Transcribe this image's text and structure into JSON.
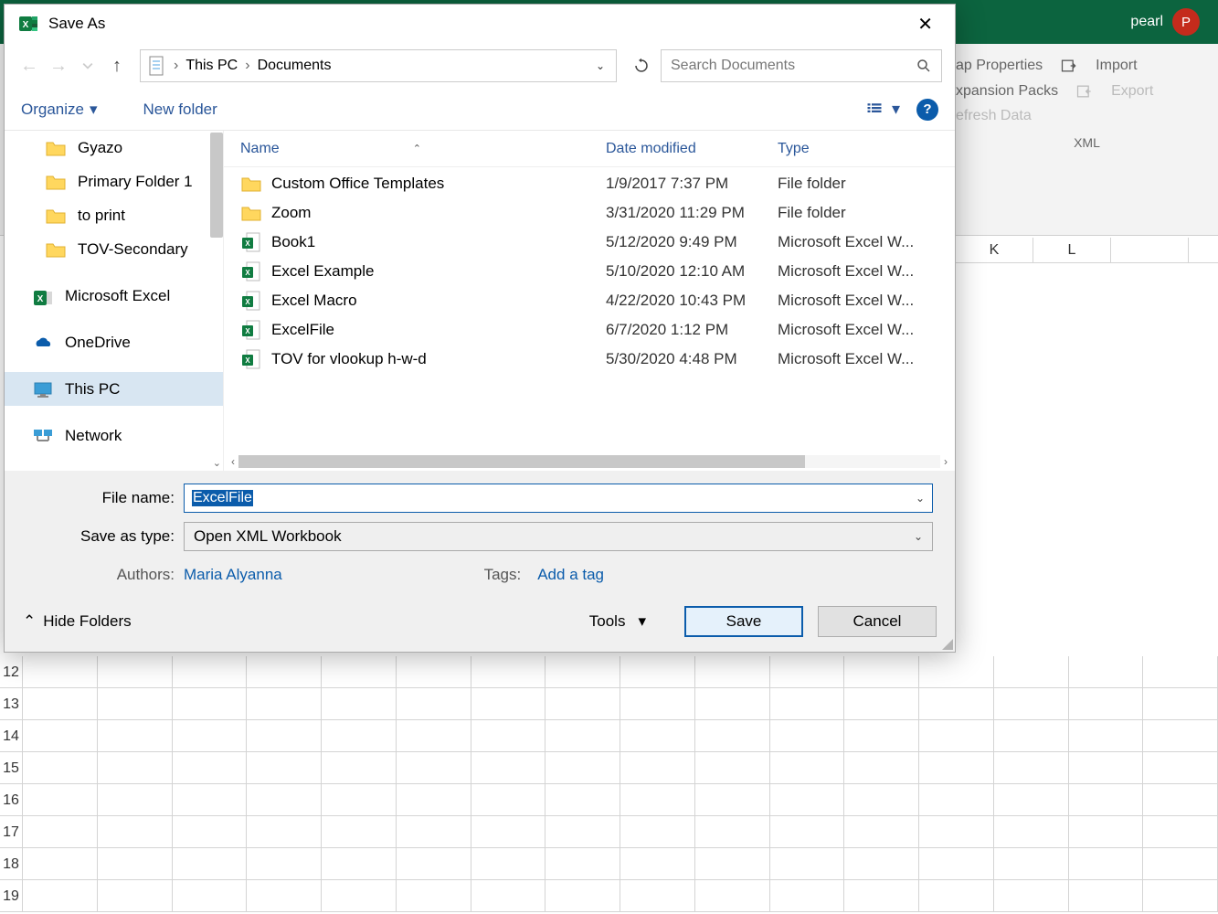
{
  "excel": {
    "user_name": "pearl",
    "user_initial": "P",
    "ribbon": {
      "group_label": "XML",
      "items": [
        "ap Properties",
        "Import",
        "xpansion Packs",
        "Export",
        "efresh Data"
      ]
    },
    "columns": [
      "K",
      "L"
    ],
    "rows_visible": [
      "12",
      "13",
      "14",
      "15",
      "16",
      "17",
      "18",
      "19"
    ]
  },
  "dialog": {
    "title": "Save As",
    "breadcrumb": [
      "This PC",
      "Documents"
    ],
    "search_placeholder": "Search Documents",
    "organize": "Organize",
    "new_folder": "New folder",
    "columns": {
      "name": "Name",
      "date": "Date modified",
      "type": "Type"
    },
    "sidebar": [
      {
        "kind": "folder",
        "label": "Gyazo"
      },
      {
        "kind": "folder",
        "label": "Primary Folder 1"
      },
      {
        "kind": "folder",
        "label": "to print"
      },
      {
        "kind": "folder",
        "label": "TOV-Secondary"
      },
      {
        "kind": "excel",
        "label": "Microsoft Excel"
      },
      {
        "kind": "onedrive",
        "label": "OneDrive"
      },
      {
        "kind": "thispc",
        "label": "This PC",
        "selected": true
      },
      {
        "kind": "network",
        "label": "Network"
      }
    ],
    "files": [
      {
        "icon": "folder",
        "name": "Custom Office Templates",
        "date": "1/9/2017 7:37 PM",
        "type": "File folder"
      },
      {
        "icon": "folder",
        "name": "Zoom",
        "date": "3/31/2020 11:29 PM",
        "type": "File folder"
      },
      {
        "icon": "excel",
        "name": "Book1",
        "date": "5/12/2020 9:49 PM",
        "type": "Microsoft Excel W..."
      },
      {
        "icon": "excel",
        "name": "Excel Example",
        "date": "5/10/2020 12:10 AM",
        "type": "Microsoft Excel W..."
      },
      {
        "icon": "excel",
        "name": "Excel Macro",
        "date": "4/22/2020 10:43 PM",
        "type": "Microsoft Excel W..."
      },
      {
        "icon": "excel",
        "name": "ExcelFile",
        "date": "6/7/2020 1:12 PM",
        "type": "Microsoft Excel W..."
      },
      {
        "icon": "excel",
        "name": "TOV for vlookup h-w-d",
        "date": "5/30/2020 4:48 PM",
        "type": "Microsoft Excel W..."
      }
    ],
    "file_name_label": "File name:",
    "file_name_value": "ExcelFile",
    "save_type_label": "Save as type:",
    "save_type_value": "Open XML Workbook",
    "authors_label": "Authors:",
    "authors_value": "Maria Alyanna",
    "tags_label": "Tags:",
    "tags_value": "Add a tag",
    "hide_folders": "Hide Folders",
    "tools": "Tools",
    "save": "Save",
    "cancel": "Cancel"
  }
}
